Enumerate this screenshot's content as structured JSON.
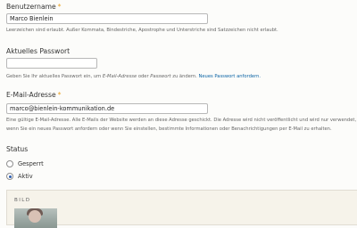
{
  "username": {
    "label": "Benutzername",
    "required_mark": "*",
    "value": "Marco Bienlein",
    "description": "Leerzeichen sind erlaubt. Außer Kommata, Bindestriche, Apostrophe und Unterstriche sind Satzzeichen nicht erlaubt."
  },
  "current_password": {
    "label": "Aktuelles Passwort",
    "value": "",
    "desc_before": "Geben Sie Ihr aktuelles Passwort ein, um ",
    "desc_email_em": "E-Mail-Adresse",
    "desc_or": " oder ",
    "desc_password_em": "Passwort",
    "desc_after": " zu ändern. ",
    "desc_link": "Neues Passwort anfordern."
  },
  "email": {
    "label": "E-Mail-Adresse",
    "required_mark": "*",
    "value": "marco@bienlein-kommunikation.de",
    "description_line1": "Eine gültige E-Mail-Adresse. Alle E-Mails der Website werden an diese Adresse geschickt. Die Adresse wird nicht veröffentlicht und wird nur verwendet,",
    "description_line2": "wenn Sie ein neues Passwort anfordern oder wenn Sie einstellen, bestimmte Informationen oder Benachrichtigungen per E-Mail zu erhalten."
  },
  "status": {
    "label": "Status",
    "options": [
      {
        "label": "Gesperrt",
        "checked": false
      },
      {
        "label": "Aktiv",
        "checked": true
      }
    ]
  },
  "picture": {
    "legend": "BILD"
  },
  "colors": {
    "required": "#e8a020",
    "link": "#0b64a5",
    "radio_checked": "#2a5db0"
  }
}
